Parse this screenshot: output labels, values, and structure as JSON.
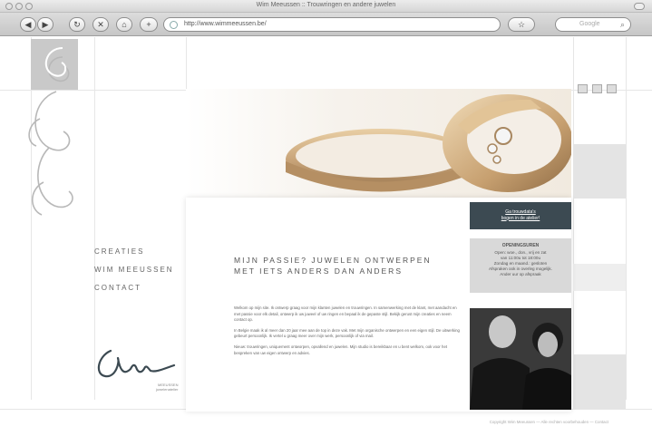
{
  "window": {
    "title": "Wim Meeussen :: Trouwringen en andere juwelen"
  },
  "toolbar": {
    "back_label": "◀",
    "forward_label": "▶",
    "reload_label": "↻",
    "stop_label": "✕",
    "home_label": "⌂",
    "address": "http://www.wimmeeussen.be/",
    "search_placeholder": "Google",
    "bookmark_label": "☆"
  },
  "nav": {
    "items": [
      {
        "label": "CREATIES"
      },
      {
        "label": "WIM MEEUSSEN"
      },
      {
        "label": "CONTACT"
      }
    ]
  },
  "main": {
    "headline_line1": "MIJN PASSIE? JUWELEN ONTWERPEN",
    "headline_line2": "MET IETS ANDERS DAN ANDERS",
    "paragraphs": [
      "Welkom op mijn site. Ik ontwerp graag voor mijn klanten juwelen en trouwringen. In samenwerking met de klant, met aandacht en met passie voor elk detail, ontwerp ik uw juweel of uw ringen en bepaal ik de gepaste stijl. Bekijk gerust mijn creaties en neem contact op.",
      "In Belgie maak ik al meer dan 20 jaar mee aan de top in deze vak. Met mijn organische ontwerpen en een eigen stijl. De uitwerking gebeurt persoonlijk. Ik vertel u graag meer over mijn werk, persoonlijk of via mail.",
      "Nieuw: trouwringen, uniquement ontworpen, opvallend en juwelen. Mijn studio is bereikbaar en u bent welkom, ook voor het bespreken van uw eigen ontwerp en advies."
    ]
  },
  "sidebar": {
    "cta_line1": "Ga trouwdata's",
    "cta_line2": "bogen in de atelier!",
    "hours_title": "OPENINGSUREN",
    "hours_lines": [
      "Open: woe., don., vrij en zat",
      "van 11:00u tot 18:00u",
      "Zondag en maand.: gesloten",
      "Afspraken ook in overleg mogelijk.",
      "Ander uur op afspraak"
    ]
  },
  "signature": {
    "sub_line1": "MEEUSSEN",
    "sub_line2": "juwelenatelier"
  },
  "footer": {
    "text": "Copyright Wim Meeussen — Alle rechten voorbehouden — Contact"
  },
  "colors": {
    "accent_dark": "#3c4a52",
    "panel_gray": "#d9d9d9",
    "gold": "#c9a57a"
  }
}
